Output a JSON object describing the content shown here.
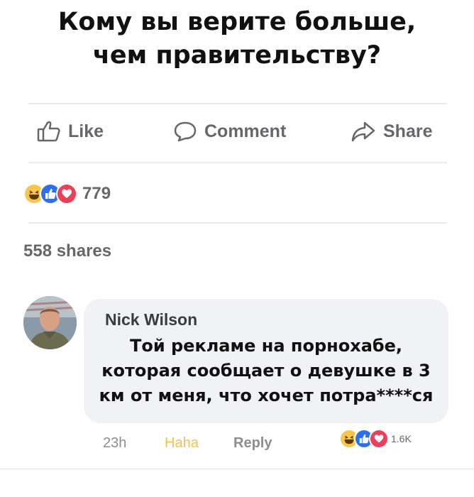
{
  "meme": {
    "headline": [
      "Кому вы верите больше,",
      "чем правительству?"
    ]
  },
  "post": {
    "actions": [
      {
        "icon": "thumbs-up-icon",
        "label": "Like"
      },
      {
        "icon": "comment-icon",
        "label": "Comment"
      },
      {
        "icon": "share-icon",
        "label": "Share"
      }
    ],
    "reactions": {
      "icons": [
        "haha-reaction-icon",
        "like-reaction-icon",
        "love-reaction-icon"
      ],
      "count": "779"
    },
    "shares_text": "558 shares"
  },
  "comment": {
    "author": "Nick Wilson",
    "text_lines": [
      "Той рекламе на порнохабе,",
      "которая сообщает о девушке в 3",
      "км от меня, что хочет потра****ся"
    ],
    "time": "23h",
    "haha_label": "Haha",
    "reply_label": "Reply",
    "reaction_count": "1.6K"
  },
  "colors": {
    "like_blue": "#2c70f0",
    "love_red": "#ee3f58",
    "haha_yellow": "#f7c64a",
    "meta_gray": "#65676b"
  }
}
